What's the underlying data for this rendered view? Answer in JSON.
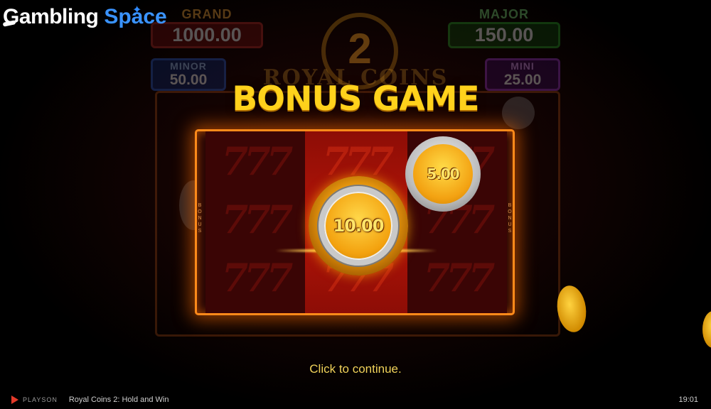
{
  "watermark": {
    "word1": "Gambling",
    "word2": "Space"
  },
  "jackpots": {
    "grand": {
      "label": "GRAND",
      "value": "1000.00"
    },
    "major": {
      "label": "MAJOR",
      "value": "150.00"
    },
    "minor": {
      "label": "MINOR",
      "value": "50.00"
    },
    "mini": {
      "label": "MINI",
      "value": "25.00"
    }
  },
  "game_logo": {
    "number": "2",
    "name": "ROYAL COINS"
  },
  "headline": "BONUS GAME",
  "panel": {
    "side_label": "BONUS",
    "symbol": "777",
    "coins": [
      {
        "value": "10.00",
        "type": "gold-silver-ring"
      },
      {
        "value": "5.00",
        "type": "silver-rim"
      }
    ]
  },
  "prompt": "Click to continue.",
  "footer": {
    "brand": "PLAYSON",
    "game_title": "Royal Coins 2: Hold and Win",
    "clock": "19:01"
  },
  "colors": {
    "headline": "#ffd21c",
    "panel_border": "#ff8a1a",
    "prompt": "#f0d25a"
  }
}
